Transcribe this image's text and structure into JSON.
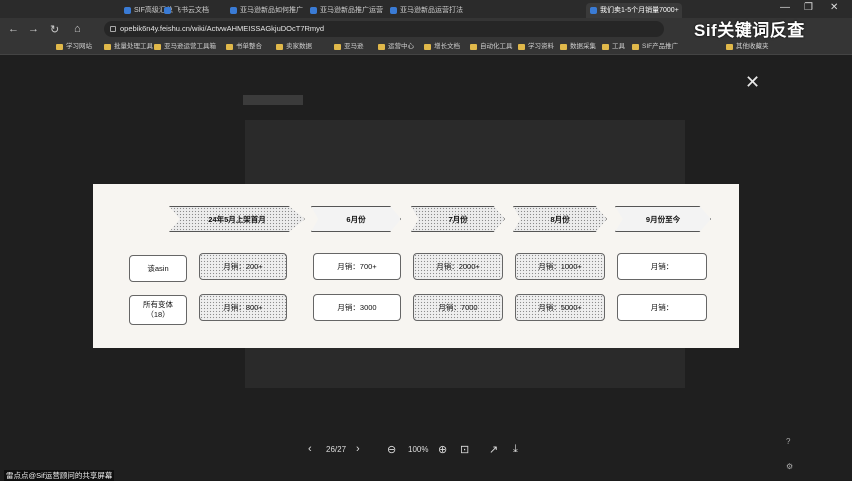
{
  "browser": {
    "tabs": [
      {
        "label": "SIF高级汇总"
      },
      {
        "label": "飞书云文档"
      },
      {
        "label": "亚马逊新品如何推广"
      },
      {
        "label": "亚马逊新品推广运营"
      },
      {
        "label": "亚马逊新品运营打法"
      },
      {
        "label": "我们卖1-5个月销量7000+"
      }
    ],
    "url": "opebik6n4y.feishu.cn/wiki/ActvwAHMEISSAGkjuDOcT7Rmyd",
    "bookmarks": [
      "学习网站",
      "批量处理工具",
      "亚马逊运营工具箱",
      "书单整合",
      "卖家数据",
      "亚马逊",
      "运营中心",
      "增长文档",
      "自动化工具",
      "学习资料",
      "数据采集",
      "工具",
      "SIF产品推广",
      "其他收藏夹"
    ],
    "window_controls": {
      "minimize": "—",
      "restore": "❐",
      "close": "✕"
    }
  },
  "overlay_brand": "Sif关键词反查",
  "viewer": {
    "close_symbol": "✕",
    "page_indicator": "26/27",
    "zoom": "100%",
    "prev_symbol": "‹",
    "next_symbol": "›",
    "zoom_out_symbol": "⊖",
    "zoom_in_symbol": "⊕",
    "fit_symbol": "⊡",
    "download_symbol": "⤓"
  },
  "slide": {
    "stages": [
      "24年5月上架首月",
      "6月份",
      "7月份",
      "8月份",
      "9月份至今"
    ],
    "row_labels": [
      {
        "line1": "该asin",
        "line2": ""
      },
      {
        "line1": "所有变体",
        "line2": "（18）"
      }
    ],
    "rows": [
      [
        "月销：200+",
        "月销：700+",
        "月销：2000+",
        "月销：1000+",
        "月销："
      ],
      [
        "月销：800+",
        "月销：3000",
        "月销：7000",
        "月销：5000+",
        "月销："
      ]
    ]
  },
  "footer_text": "雷点点@Sif运营顾问的共享屏幕"
}
